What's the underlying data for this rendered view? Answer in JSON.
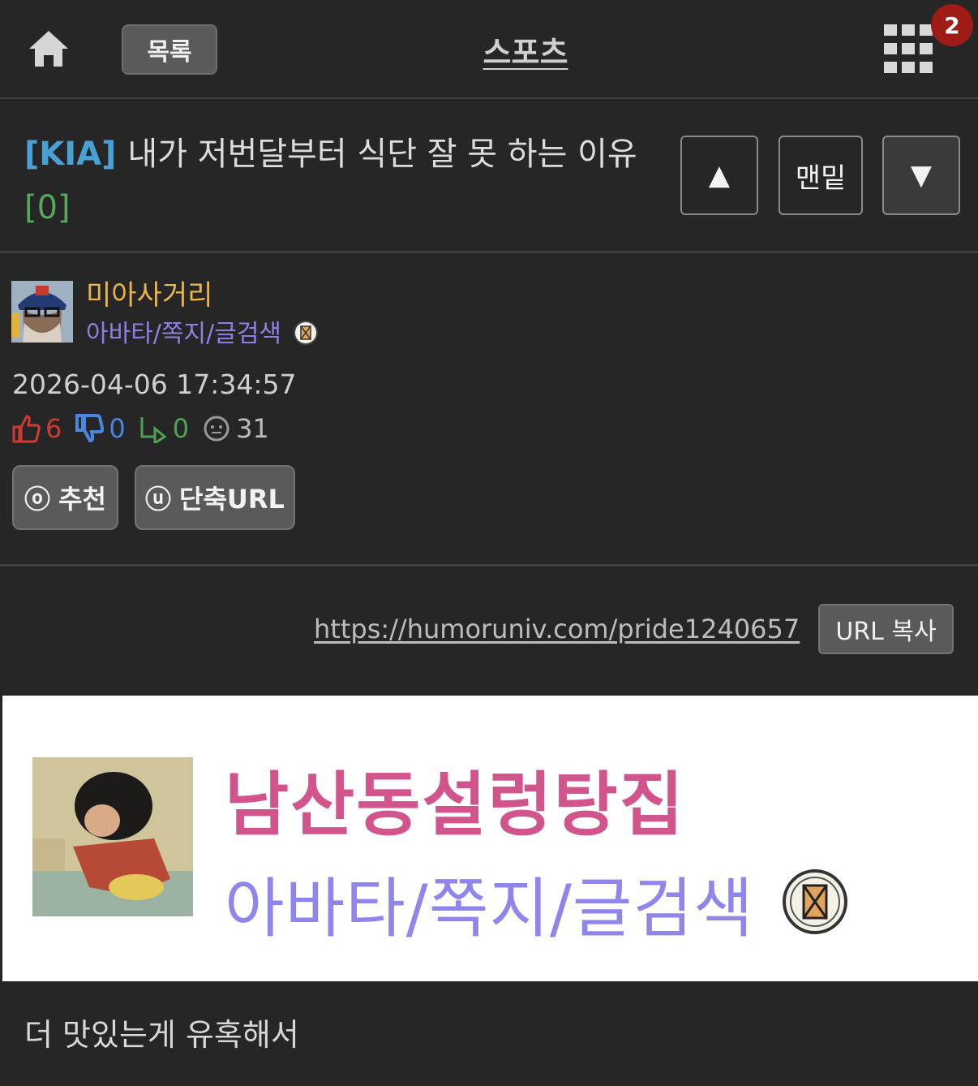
{
  "header": {
    "list_label": "목록",
    "board_title": "스포츠",
    "notification_count": "2"
  },
  "post": {
    "tag": "[KIA]",
    "title": "내가 저번달부터 식단 잘 못 하는 이유",
    "comment_count": "[0]",
    "nav": {
      "up": "▲",
      "bottom": "맨밑",
      "down": "▼"
    }
  },
  "author": {
    "name": "미아사거리",
    "links": "아바타/쪽지/글검색",
    "date": "2026-04-06 17:34:57"
  },
  "stats": {
    "up": "6",
    "down": "0",
    "reply": "0",
    "views": "31"
  },
  "actions": {
    "recommend_icon": "ⓞ",
    "recommend_label": "추천",
    "shorturl_icon": "ⓤ",
    "shorturl_label": "단축URL"
  },
  "url": {
    "link": "https://humoruniv.com/pride1240657",
    "copy_label": "URL 복사"
  },
  "embed": {
    "name": "남산동설렁탕집",
    "links": "아바타/쪽지/글검색"
  },
  "content": {
    "body": "더 맛있는게 유혹해서"
  },
  "colors": {
    "background": "#262626",
    "tag": "#4aa1d6",
    "comment_count": "#56a85a",
    "author_name": "#e9b44a",
    "author_links": "#8c80e8",
    "up": "#cf3a33",
    "down": "#4a86e0",
    "reply": "#4fa254",
    "embed_name": "#d2548c",
    "embed_links": "#8f86ec",
    "badge": "#9e1c15"
  }
}
